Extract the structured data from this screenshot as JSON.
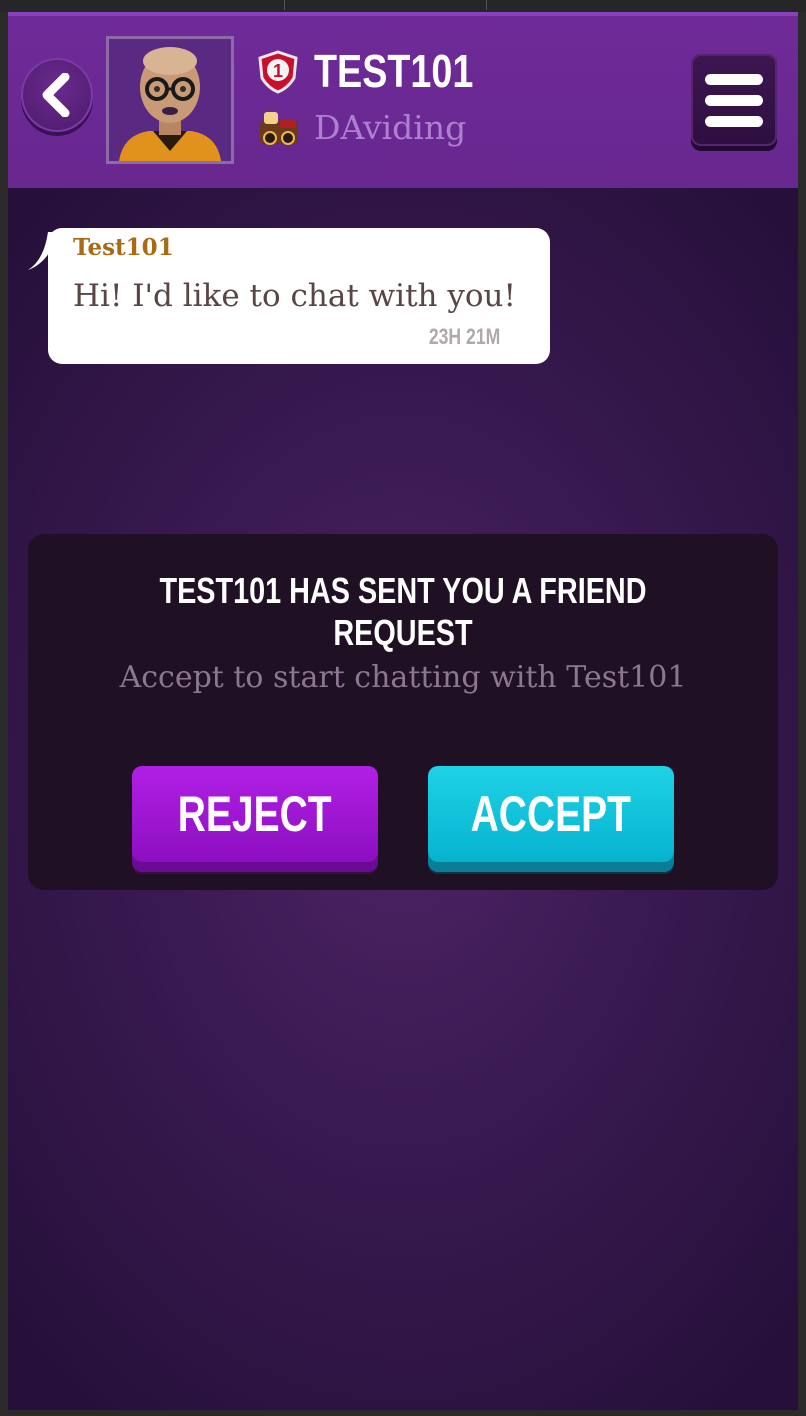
{
  "header": {
    "player_name": "TEST101",
    "team_name": "DAviding",
    "rank_number": "1",
    "icons": {
      "back": "chevron-left-icon",
      "menu": "hamburger-menu-icon",
      "rank": "shield-rank-icon",
      "team": "team-badge-icon"
    }
  },
  "message": {
    "sender": "Test101",
    "text": "Hi! I'd like to chat with you!",
    "time": "23H 21M"
  },
  "friend_request": {
    "title": "TEST101 HAS SENT YOU A FRIEND REQUEST",
    "subtitle": "Accept to start chatting with Test101",
    "reject_label": "REJECT",
    "accept_label": "ACCEPT"
  },
  "colors": {
    "header_purple": "#6f2a98",
    "reject_purple": "#a516d8",
    "accept_cyan": "#11c4dc",
    "sender_gold": "#a86a14"
  }
}
